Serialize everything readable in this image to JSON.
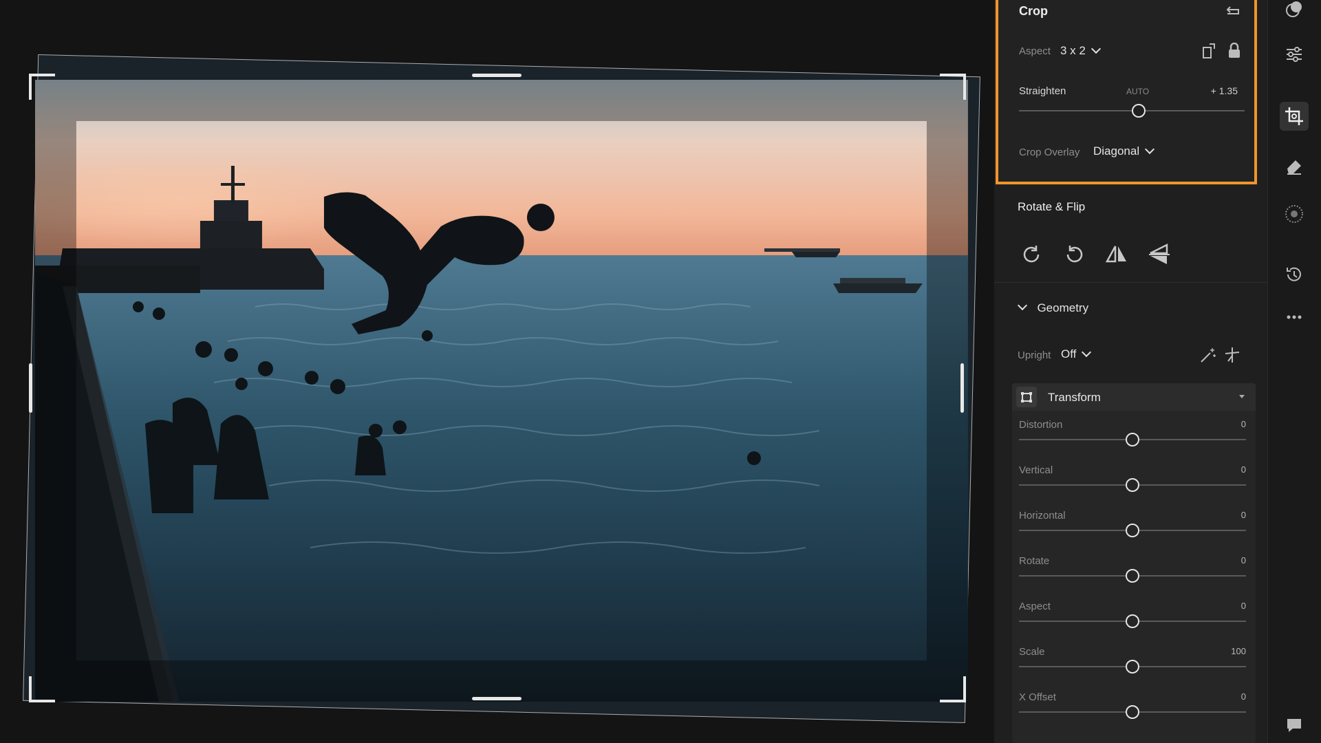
{
  "crop": {
    "title": "Crop",
    "aspect_label": "Aspect",
    "aspect_value": "3 x 2",
    "straighten_label": "Straighten",
    "straighten_auto": "AUTO",
    "straighten_value": "+ 1.35",
    "straighten_position": 0.53,
    "overlay_label": "Crop Overlay",
    "overlay_value": "Diagonal"
  },
  "rotate_flip": {
    "title": "Rotate & Flip",
    "buttons": [
      "rotate-clockwise-icon",
      "rotate-counterclockwise-icon",
      "flip-horizontal-icon",
      "flip-vertical-icon"
    ]
  },
  "geometry": {
    "title": "Geometry",
    "upright_label": "Upright",
    "upright_value": "Off",
    "transform_title": "Transform",
    "sliders": [
      {
        "label": "Distortion",
        "value": "0",
        "position": 0.5
      },
      {
        "label": "Vertical",
        "value": "0",
        "position": 0.5
      },
      {
        "label": "Horizontal",
        "value": "0",
        "position": 0.5
      },
      {
        "label": "Rotate",
        "value": "0",
        "position": 0.5
      },
      {
        "label": "Aspect",
        "value": "0",
        "position": 0.5
      },
      {
        "label": "Scale",
        "value": "100",
        "position": 0.5
      },
      {
        "label": "X Offset",
        "value": "0",
        "position": 0.5
      }
    ]
  },
  "toolbar": {
    "tools": [
      "masking-icon",
      "edit-sliders-icon",
      "crop-icon",
      "healing-eraser-icon",
      "red-eye-icon",
      "history-icon",
      "more-icon",
      "comments-icon"
    ],
    "active": "crop-icon"
  },
  "colors": {
    "accent": "#f0962a",
    "panel": "#1f1f1f",
    "background": "#141414"
  }
}
